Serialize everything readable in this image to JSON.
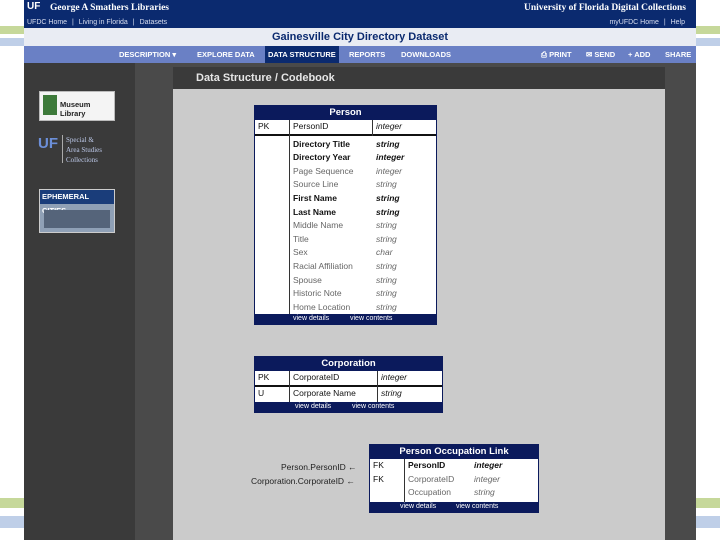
{
  "header": {
    "uf_logo": "UF",
    "library_name": "George A Smathers Libraries",
    "collection_name": "University of Florida Digital Collections",
    "left_links": [
      "UFDC Home",
      "|",
      "Living in Florida",
      "|",
      "Datasets"
    ],
    "right_links": [
      "myUFDC Home",
      "|",
      "Help"
    ],
    "dataset_title": "Gainesville City Directory Dataset"
  },
  "nav": {
    "description": "DESCRIPTION",
    "explore": "EXPLORE DATA",
    "structure": "DATA STRUCTURE",
    "reports": "REPORTS",
    "downloads": "DOWNLOADS",
    "print": "PRINT",
    "send": "SEND",
    "add": "ADD",
    "share": "SHARE"
  },
  "sidebar": {
    "logo1": "Museum Library",
    "logo2_uf": "UF",
    "logo2_text": [
      "Special &",
      "Area Studies",
      "Collections"
    ],
    "logo3": "EPHEMERAL CITIES"
  },
  "section": {
    "title": "Data Structure / Codebook"
  },
  "person": {
    "title": "Person",
    "key_row": {
      "key": "PK",
      "name": "PersonID",
      "type": "integer"
    },
    "fields": [
      {
        "name": "Directory Title",
        "type": "string",
        "style": "strong"
      },
      {
        "name": "Directory Year",
        "type": "integer",
        "style": "strong"
      },
      {
        "name": "Page Sequence",
        "type": "integer",
        "style": "muted"
      },
      {
        "name": "Source Line",
        "type": "string",
        "style": "muted"
      },
      {
        "name": "First Name",
        "type": "string",
        "style": "strong"
      },
      {
        "name": "Last Name",
        "type": "string",
        "style": "strong"
      },
      {
        "name": "Middle Name",
        "type": "string",
        "style": "muted"
      },
      {
        "name": "Title",
        "type": "string",
        "style": "muted"
      },
      {
        "name": "Sex",
        "type": "char",
        "style": "muted"
      },
      {
        "name": "Racial Affiliation",
        "type": "string",
        "style": "muted"
      },
      {
        "name": "Spouse",
        "type": "string",
        "style": "muted"
      },
      {
        "name": "Historic Note",
        "type": "string",
        "style": "muted"
      },
      {
        "name": "Home Location",
        "type": "string",
        "style": "muted"
      }
    ],
    "view_details": "view details",
    "view_contents": "view contents"
  },
  "corporation": {
    "title": "Corporation",
    "rows": [
      {
        "key": "PK",
        "name": "CorporateID",
        "type": "integer"
      },
      {
        "key": "U",
        "name": "Corporate Name",
        "type": "string"
      }
    ],
    "view_details": "view details",
    "view_contents": "view contents"
  },
  "occupation": {
    "title": "Person Occupation Link",
    "rows": [
      {
        "key": "FK",
        "name": "PersonID",
        "type": "integer",
        "style": "strong"
      },
      {
        "key": "FK",
        "name": "CorporateID",
        "type": "integer",
        "style": "muted"
      },
      {
        "key": "",
        "name": "Occupation",
        "type": "string",
        "style": "muted"
      }
    ],
    "links": [
      "Person.PersonID",
      "Corporation.CorporateID"
    ],
    "view_details": "view details",
    "view_contents": "view contents"
  },
  "colors": {
    "navy": "#0b2a6f",
    "nav_blue": "#6a80c5",
    "frame": "#3a3a3a",
    "canvas": "#cbcbcb",
    "deco_green": "#c6d89a",
    "deco_blue": "#bfcfe8"
  }
}
